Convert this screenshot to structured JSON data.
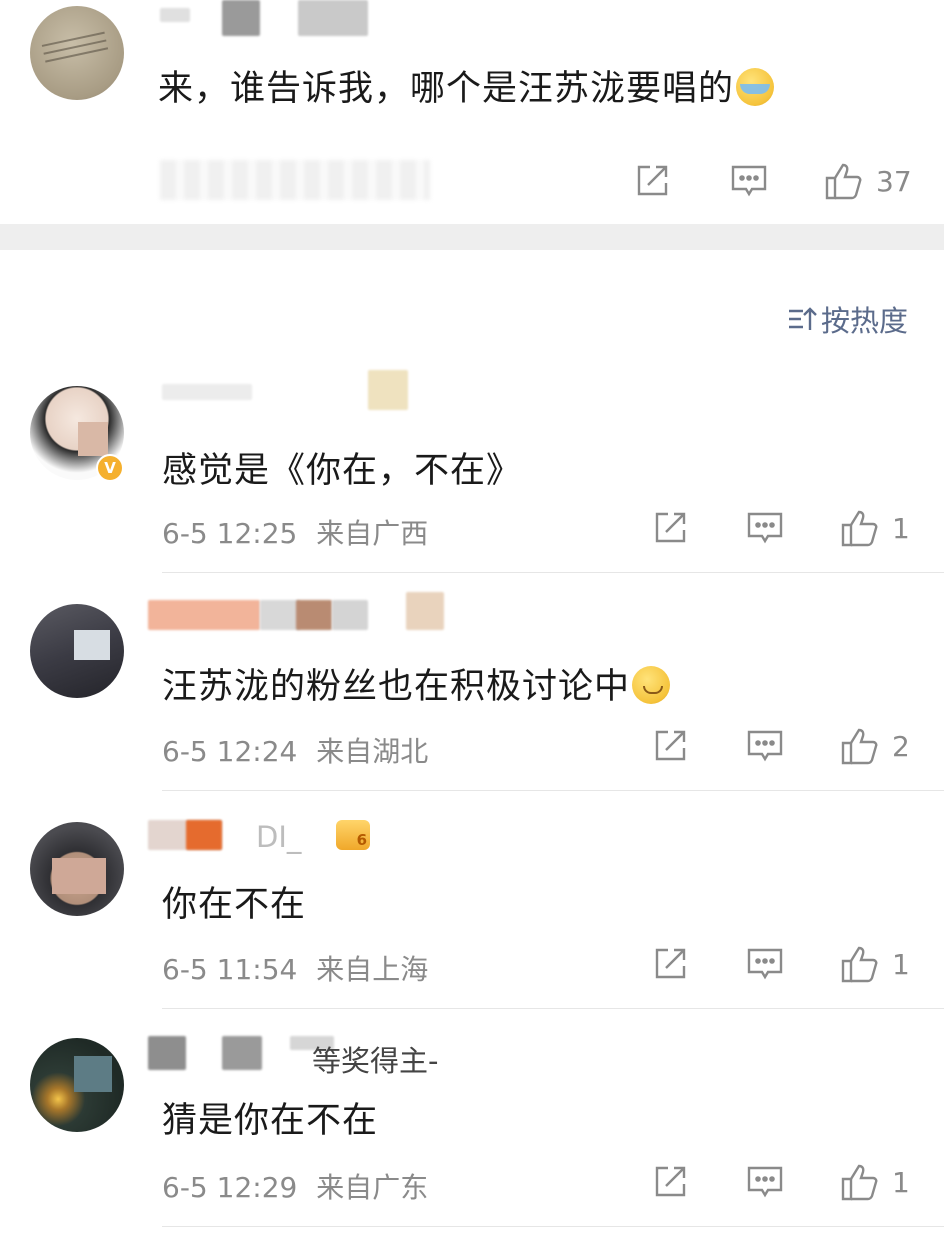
{
  "post": {
    "text": "来，谁告诉我，哪个是汪苏泷要唱的",
    "emoji": "laugh-cry-emoji",
    "like_count": "37"
  },
  "sort": {
    "label": "按热度",
    "icon": "sort-icon"
  },
  "comments": [
    {
      "text": "感觉是《你在，不在》",
      "time": "6-5 12:25",
      "location": "来自广西",
      "like_count": "1",
      "verified": true,
      "verified_mark": "V"
    },
    {
      "text": "汪苏泷的粉丝也在积极讨论中",
      "emoji": "sweat-smile-emoji",
      "time": "6-5 12:24",
      "location": "来自湖北",
      "like_count": "2"
    },
    {
      "text": "你在不在",
      "time": "6-5 11:54",
      "location": "来自上海",
      "like_count": "1",
      "name_visible": "DI_",
      "level": "6"
    },
    {
      "text": "猜是你在不在",
      "time": "6-5 12:29",
      "location": "来自广东",
      "like_count": "1",
      "title_tag": "等奖得主-"
    }
  ],
  "colors": {
    "sort": "#5b6b8b",
    "meta": "#8a8a8a",
    "band": "#eeeeee"
  }
}
